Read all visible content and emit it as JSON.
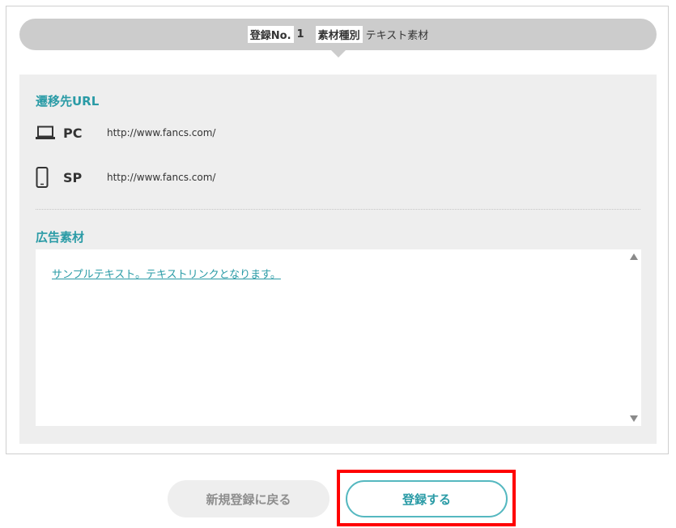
{
  "header": {
    "reg_no_label": "登録No.",
    "reg_no_value": "1",
    "material_type_label": "素材種別",
    "material_type_value": "テキスト素材"
  },
  "destination": {
    "title": "遷移先URL",
    "rows": [
      {
        "icon": "laptop-icon",
        "device": "PC",
        "url": "http://www.fancs.com/"
      },
      {
        "icon": "smartphone-icon",
        "device": "SP",
        "url": "http://www.fancs.com/"
      }
    ]
  },
  "ad_material": {
    "title": "広告素材",
    "link_text": "サンプルテキスト。テキストリンクとなります。"
  },
  "buttons": {
    "back_label": "新規登録に戻る",
    "submit_label": "登録する"
  },
  "colors": {
    "accent": "#2a9ba6",
    "highlight": "#ff0000",
    "header_bg": "#cccccc",
    "panel_bg": "#eeeeee"
  }
}
